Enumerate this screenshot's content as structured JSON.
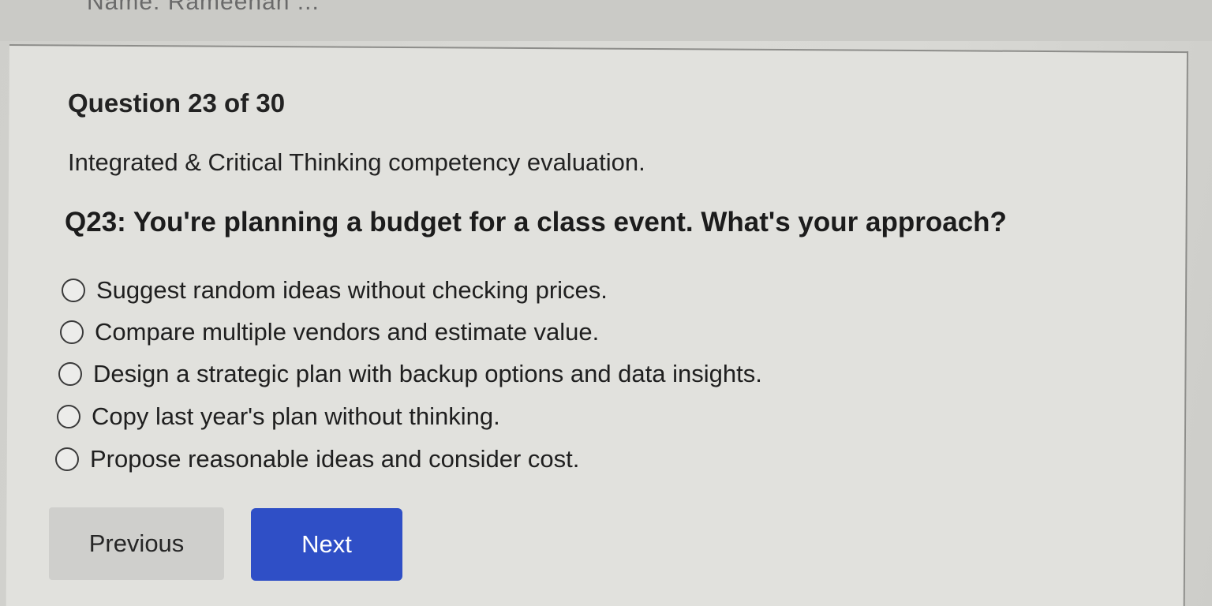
{
  "top_strip": {
    "cut_text": "Name: Rameenah ..."
  },
  "quiz": {
    "counter": "Question 23 of 30",
    "subtitle": "Integrated & Critical Thinking competency evaluation.",
    "question": "Q23: You're planning a budget for a class event. What's your approach?",
    "options": [
      {
        "label": "Suggest random ideas without checking prices.",
        "selected": false
      },
      {
        "label": "Compare multiple vendors and estimate value.",
        "selected": false
      },
      {
        "label": "Design a strategic plan with backup options and data insights.",
        "selected": false
      },
      {
        "label": "Copy last year's plan without thinking.",
        "selected": false
      },
      {
        "label": "Propose reasonable ideas and consider cost.",
        "selected": false
      }
    ]
  },
  "nav": {
    "previous_label": "Previous",
    "next_label": "Next"
  },
  "colors": {
    "next_button": "#2f4fc6",
    "previous_button": "#cfcfcc",
    "background": "#d9d9d5"
  }
}
